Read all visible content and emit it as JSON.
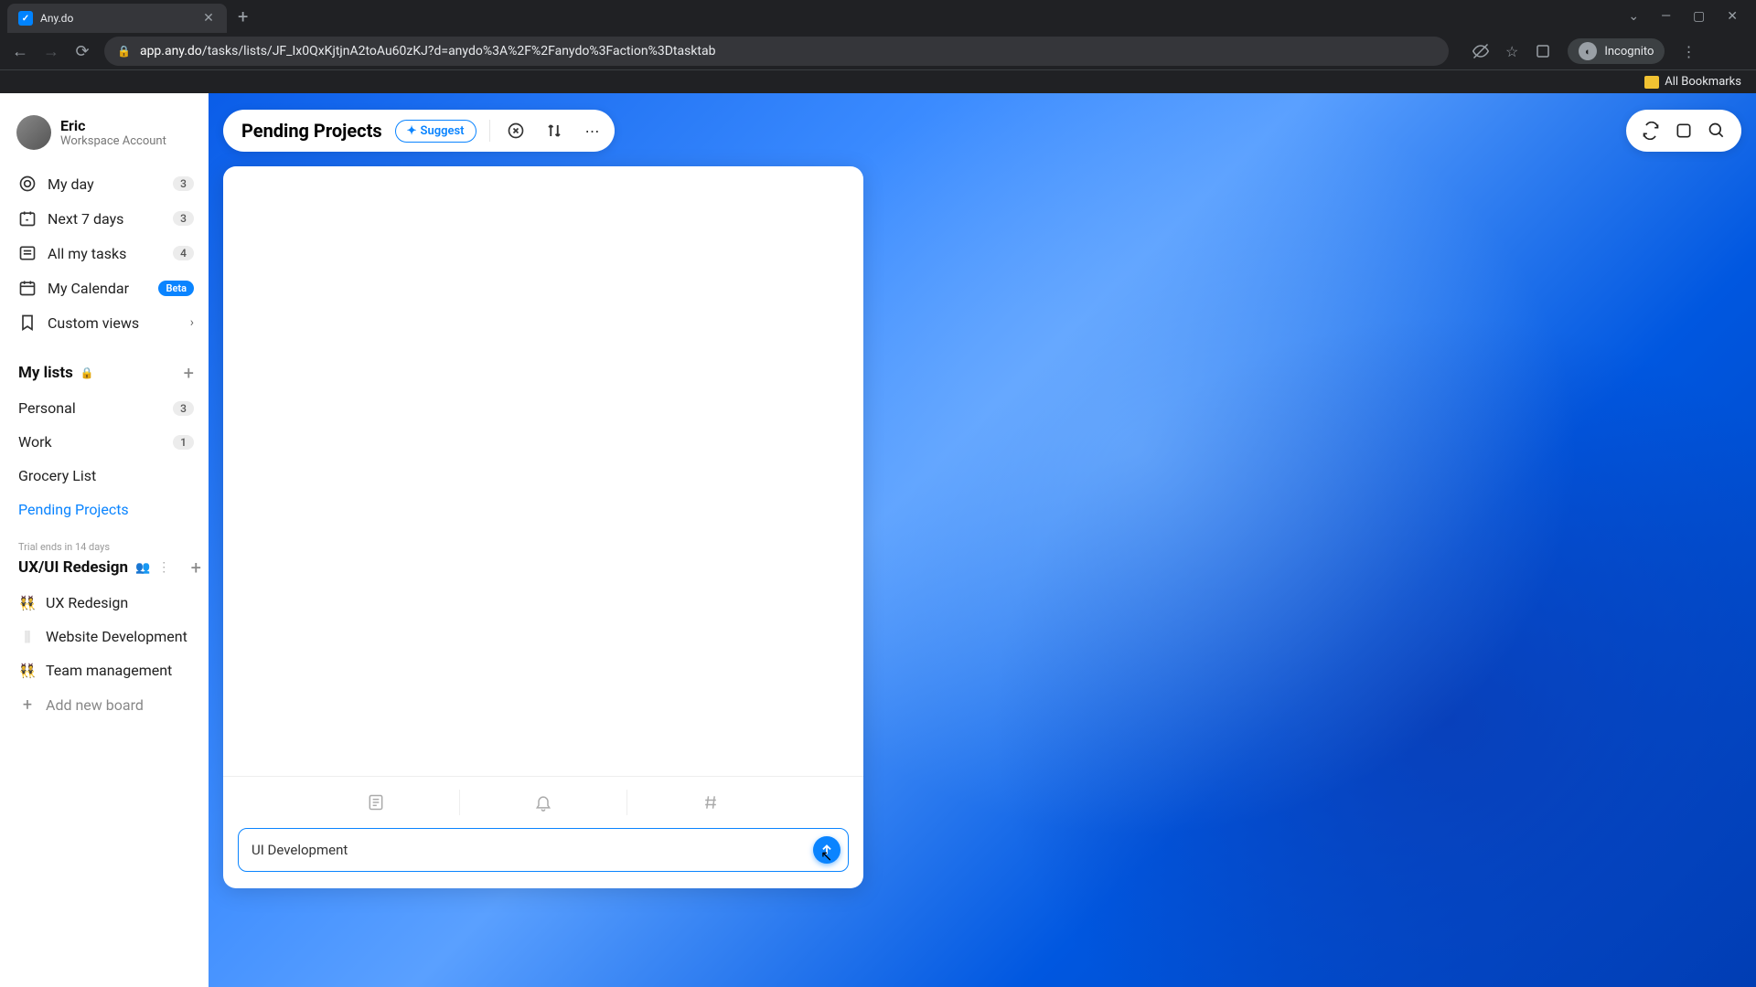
{
  "browser": {
    "tab_title": "Any.do",
    "url_domain": "app.any.do",
    "url_path": "/tasks/lists/JF_Ix0QxKjtjnA2toAu60zKJ?d=anydo%3A%2F%2Fanydo%3Faction%3Dtasktab",
    "incognito_label": "Incognito",
    "bookmarks_label": "All Bookmarks"
  },
  "profile": {
    "name": "Eric",
    "subtitle": "Workspace Account"
  },
  "nav": {
    "my_day": {
      "label": "My day",
      "count": "3"
    },
    "next7": {
      "label": "Next 7 days",
      "count": "3"
    },
    "all_tasks": {
      "label": "All my tasks",
      "count": "4"
    },
    "calendar": {
      "label": "My Calendar",
      "badge": "Beta"
    },
    "custom_views": {
      "label": "Custom views"
    }
  },
  "lists": {
    "header": "My lists",
    "items": {
      "personal": {
        "label": "Personal",
        "count": "3"
      },
      "work": {
        "label": "Work",
        "count": "1"
      },
      "grocery": {
        "label": "Grocery List"
      },
      "pending": {
        "label": "Pending Projects"
      }
    }
  },
  "workspace": {
    "trial_note": "Trial ends in 14 days",
    "name": "UX/UI Redesign",
    "boards": {
      "ux": {
        "label": "UX Redesign"
      },
      "web": {
        "label": "Website Development"
      },
      "team": {
        "label": "Team management"
      }
    },
    "add_board": "Add new board"
  },
  "main": {
    "title": "Pending Projects",
    "suggest": "Suggest"
  },
  "task_input": {
    "value": "UI Development"
  }
}
